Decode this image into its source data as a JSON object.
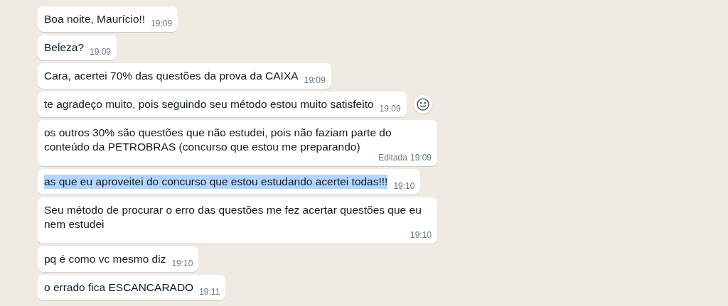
{
  "messages": [
    {
      "text": "Boa noite, Maurício!!",
      "time": "19:09",
      "highlighted": false,
      "reaction_button": false
    },
    {
      "text": "Beleza?",
      "time": "19:09",
      "highlighted": false,
      "reaction_button": false
    },
    {
      "text": "Cara, acertei 70% das questões da prova da CAIXA",
      "time": "19:09",
      "highlighted": false,
      "reaction_button": false
    },
    {
      "text": "te agradeço muito, pois seguindo seu método estou muito satisfeito",
      "time": "19:09",
      "highlighted": false,
      "reaction_button": true
    },
    {
      "text": "os outros 30% são questões que não estudei, pois não faziam parte do conteúdo da PETROBRAS (concurso que estou me preparando)",
      "time": "19:09",
      "edited_label": "Editada",
      "highlighted": false,
      "reaction_button": false
    },
    {
      "text": "as que eu aproveitei do concurso que estou estudando acertei todas!!!",
      "time": "19:10",
      "highlighted": true,
      "reaction_button": false
    },
    {
      "text": "Seu método de procurar o erro das questões me fez acertar questões que eu nem estudei",
      "time": "19:10",
      "highlighted": false,
      "reaction_button": false
    },
    {
      "text": "pq é como vc mesmo diz",
      "time": "19:10",
      "highlighted": false,
      "reaction_button": false
    },
    {
      "text": "o errado fica ESCANCARADO",
      "time": "19:11",
      "highlighted": false,
      "reaction_button": false
    }
  ]
}
